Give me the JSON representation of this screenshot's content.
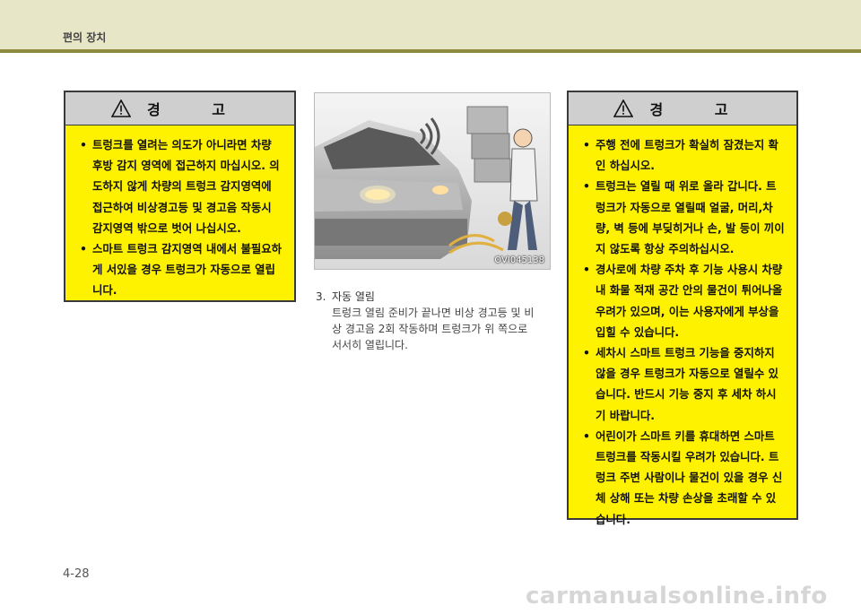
{
  "header": {
    "section_title": "편의 장치"
  },
  "warning_left": {
    "title": "경 고",
    "items": [
      "트렁크를 열려는 의도가 아니라면 차량 후방 감지 영역에 접근하지 마십시오. 의도하지 않게 차량의 트렁크 감지영역에 접근하여 비상경고등 및 경고음 작동시 감지영역 밖으로 벗어 나십시오.",
      "스마트 트렁크 감지영역 내에서 불필요하게 서있을 경우 트렁크가 자동으로 열립니다."
    ]
  },
  "figure": {
    "code": "OVI045138"
  },
  "step": {
    "number": "3.",
    "heading": "자동 열림",
    "body": "트렁크 열림 준비가 끝나면 비상 경고등 및 비상 경고음 2회 작동하며 트렁크가 위 쪽으로 서서히 열립니다."
  },
  "warning_right": {
    "title": "경 고",
    "items": [
      "주행 전에 트렁크가 확실히 잠겼는지 확인 하십시오.",
      "트렁크는 열릴 때 위로 올라 갑니다. 트렁크가 자동으로 열릴때 얼굴, 머리,차량, 벽 등에 부딪히거나 손, 발 등이 끼이지 않도록 항상 주의하십시오.",
      "경사로에 차량 주차 후 기능 사용시 차량 내 화물 적재 공간 안의 물건이 튀어나올 우려가 있으며, 이는 사용자에게 부상을 입힐 수 있습니다.",
      "세차시 스마트 트렁크 기능을 중지하지 않을 경우 트렁크가 자동으로 열릴수 있습니다. 반드시 기능 중지 후 세차 하시기 바랍니다.",
      "어린이가 스마트 키를 휴대하면 스마트 트렁크를 작동시킬 우려가 있습니다. 트렁크 주변 사람이나 물건이 있을 경우 신체 상해 또는 차량 손상을 초래할 수 있습니다."
    ]
  },
  "footer": {
    "page_number": "4-28",
    "watermark": "carmanualsonline.info"
  },
  "colors": {
    "warning_fill": "#fff200",
    "warning_header": "#cfcfcf",
    "header_band": "#e7e6c6",
    "header_rule": "#8d8a3d"
  },
  "icons": [
    "warning-triangle-icon"
  ]
}
